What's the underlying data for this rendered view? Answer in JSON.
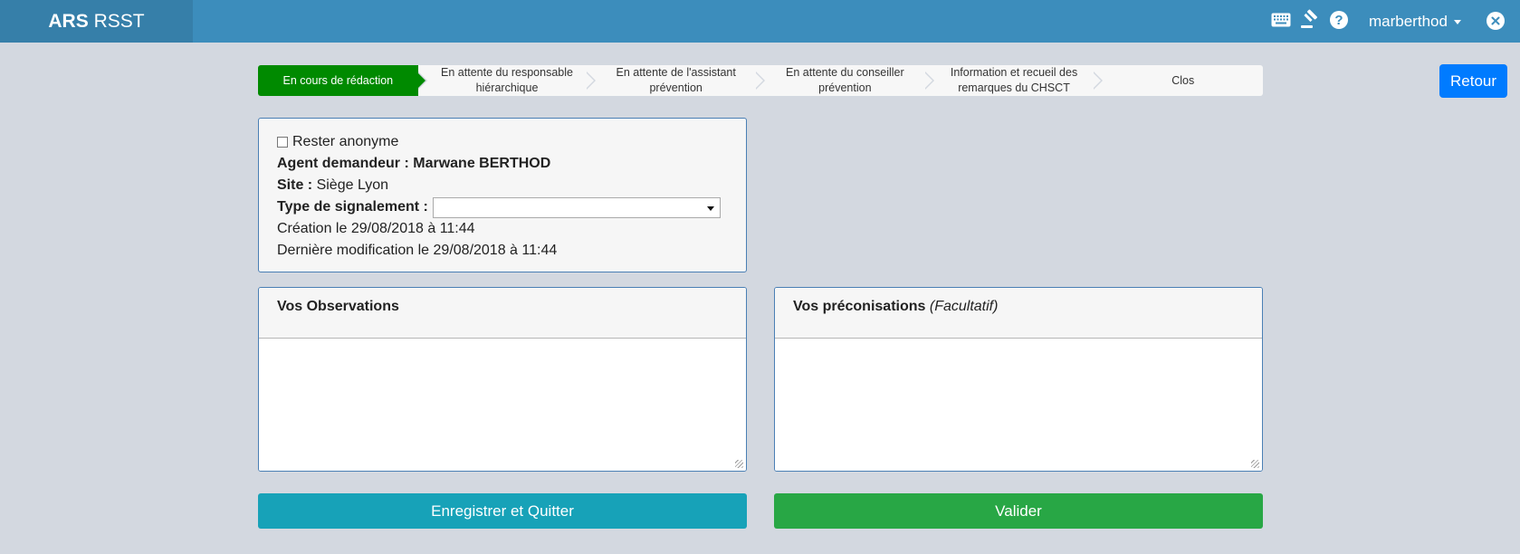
{
  "navbar": {
    "brand_bold": "ARS",
    "brand_rest": "RSST",
    "icons": [
      "keyboard-icon",
      "gavel-icon",
      "help-icon"
    ],
    "user": "marberthod",
    "colors": {
      "navbar": "#3c8dbc",
      "brand_bg": "#367fa9"
    }
  },
  "workflow": {
    "steps": [
      {
        "label": "En cours de rédaction",
        "active": true
      },
      {
        "label": "En attente du responsable hiérarchique",
        "active": false
      },
      {
        "label": "En attente de l'assistant prévention",
        "active": false
      },
      {
        "label": "En attente du conseiller prévention",
        "active": false
      },
      {
        "label": "Information et recueil des remarques du CHSCT",
        "active": false
      },
      {
        "label": "Clos",
        "active": false
      }
    ],
    "active_color": "#008a00"
  },
  "retour_label": "Retour",
  "info": {
    "anonymous_label": "Rester anonyme",
    "agent_label": "Agent demandeur :",
    "agent_value": "Marwane BERTHOD",
    "site_label": "Site :",
    "site_value": "Siège Lyon",
    "type_label": "Type de signalement :",
    "type_value": "",
    "creation": "Création le 29/08/2018 à 11:44",
    "modification": "Dernière modification le 29/08/2018 à 11:44"
  },
  "observations": {
    "title": "Vos Observations",
    "value": ""
  },
  "preconisations": {
    "title": "Vos préconisations",
    "optional": "(Facultatif)",
    "value": ""
  },
  "buttons": {
    "save_quit": "Enregistrer et Quitter",
    "validate": "Valider",
    "save_color": "#17a2b8",
    "validate_color": "#28a745"
  }
}
